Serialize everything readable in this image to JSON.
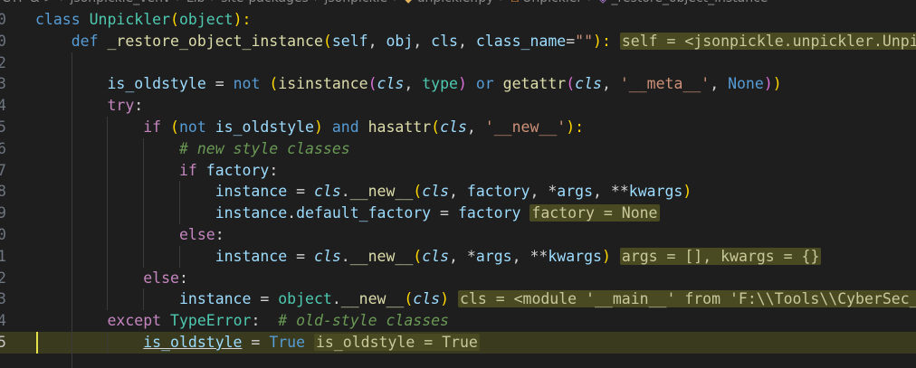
{
  "breadcrumb": {
    "items": [
      "CTF & >",
      "jsonpickle_venv",
      "Lib",
      "site-packages",
      "jsonpickle",
      "unpickler.py",
      "Unpickler",
      "_restore_object_instance"
    ]
  },
  "editor": {
    "lines": [
      {
        "number": "0",
        "tokens": [
          [
            "kw",
            "class "
          ],
          [
            "cls",
            "Unpickler"
          ],
          [
            "paren1",
            "("
          ],
          [
            "cls",
            "object"
          ],
          [
            "paren1",
            "):"
          ]
        ]
      },
      {
        "number": "0",
        "tokens": [
          [
            "pun",
            "    "
          ],
          [
            "kw",
            "def "
          ],
          [
            "fn",
            "_restore_object_instance"
          ],
          [
            "paren1",
            "("
          ],
          [
            "param",
            "self"
          ],
          [
            "pun",
            ", "
          ],
          [
            "param",
            "obj"
          ],
          [
            "pun",
            ", "
          ],
          [
            "param",
            "cls"
          ],
          [
            "pun",
            ", "
          ],
          [
            "param",
            "class_name"
          ],
          [
            "op",
            "="
          ],
          [
            "str",
            "\"\""
          ],
          [
            "paren1",
            "):"
          ],
          [
            "pun",
            " "
          ],
          [
            "inlay",
            "self = <jsonpickle.unpickler.Unpickl"
          ]
        ]
      },
      {
        "number": "2",
        "tokens": []
      },
      {
        "number": "3",
        "tokens": [
          [
            "pun",
            "        "
          ],
          [
            "var",
            "is_oldstyle"
          ],
          [
            "op",
            " = "
          ],
          [
            "kw",
            "not "
          ],
          [
            "paren1",
            "("
          ],
          [
            "fn",
            "isinstance"
          ],
          [
            "paren2",
            "("
          ],
          [
            "cls-ital",
            "cls"
          ],
          [
            "pun",
            ", "
          ],
          [
            "cls",
            "type"
          ],
          [
            "paren2",
            ")"
          ],
          [
            "kw",
            " or "
          ],
          [
            "fn",
            "getattr"
          ],
          [
            "paren2",
            "("
          ],
          [
            "cls-ital",
            "cls"
          ],
          [
            "pun",
            ", "
          ],
          [
            "str",
            "'__meta__'"
          ],
          [
            "pun",
            ", "
          ],
          [
            "constb",
            "None"
          ],
          [
            "paren2",
            ")"
          ],
          [
            "paren1",
            ")"
          ]
        ]
      },
      {
        "number": "4",
        "tokens": [
          [
            "pun",
            "        "
          ],
          [
            "ctrl",
            "try"
          ],
          [
            "pun",
            ":"
          ]
        ]
      },
      {
        "number": "5",
        "tokens": [
          [
            "pun",
            "            "
          ],
          [
            "ctrl",
            "if "
          ],
          [
            "paren1",
            "("
          ],
          [
            "kw",
            "not "
          ],
          [
            "var",
            "is_oldstyle"
          ],
          [
            "paren1",
            ")"
          ],
          [
            "kw",
            " and "
          ],
          [
            "fn",
            "hasattr"
          ],
          [
            "paren1",
            "("
          ],
          [
            "cls-ital",
            "cls"
          ],
          [
            "pun",
            ", "
          ],
          [
            "str",
            "'__new__'"
          ],
          [
            "paren1",
            "):"
          ]
        ]
      },
      {
        "number": "6",
        "tokens": [
          [
            "pun",
            "                "
          ],
          [
            "cmt",
            "# new style classes"
          ]
        ]
      },
      {
        "number": "7",
        "tokens": [
          [
            "pun",
            "                "
          ],
          [
            "ctrl",
            "if "
          ],
          [
            "var",
            "factory"
          ],
          [
            "pun",
            ":"
          ]
        ]
      },
      {
        "number": "8",
        "tokens": [
          [
            "pun",
            "                    "
          ],
          [
            "var",
            "instance"
          ],
          [
            "op",
            " = "
          ],
          [
            "cls-ital",
            "cls"
          ],
          [
            "pun",
            "."
          ],
          [
            "fn",
            "__new__"
          ],
          [
            "paren1",
            "("
          ],
          [
            "cls-ital",
            "cls"
          ],
          [
            "pun",
            ", "
          ],
          [
            "var",
            "factory"
          ],
          [
            "pun",
            ", "
          ],
          [
            "op",
            "*"
          ],
          [
            "var",
            "args"
          ],
          [
            "pun",
            ", "
          ],
          [
            "op",
            "**"
          ],
          [
            "var",
            "kwargs"
          ],
          [
            "paren1",
            ")"
          ]
        ]
      },
      {
        "number": "9",
        "tokens": [
          [
            "pun",
            "                    "
          ],
          [
            "var",
            "instance"
          ],
          [
            "pun",
            "."
          ],
          [
            "var",
            "default_factory"
          ],
          [
            "op",
            " = "
          ],
          [
            "var",
            "factory"
          ],
          [
            "pun",
            " "
          ],
          [
            "inlay",
            "factory = None"
          ]
        ]
      },
      {
        "number": "0",
        "tokens": [
          [
            "pun",
            "                "
          ],
          [
            "ctrl",
            "else"
          ],
          [
            "pun",
            ":"
          ]
        ]
      },
      {
        "number": "1",
        "tokens": [
          [
            "pun",
            "                    "
          ],
          [
            "var",
            "instance"
          ],
          [
            "op",
            " = "
          ],
          [
            "cls-ital",
            "cls"
          ],
          [
            "pun",
            "."
          ],
          [
            "fn",
            "__new__"
          ],
          [
            "paren1",
            "("
          ],
          [
            "cls-ital",
            "cls"
          ],
          [
            "pun",
            ", "
          ],
          [
            "op",
            "*"
          ],
          [
            "var",
            "args"
          ],
          [
            "pun",
            ", "
          ],
          [
            "op",
            "**"
          ],
          [
            "var",
            "kwargs"
          ],
          [
            "paren1",
            ")"
          ],
          [
            "pun",
            " "
          ],
          [
            "inlay",
            "args = [], kwargs = {}"
          ]
        ]
      },
      {
        "number": "2",
        "tokens": [
          [
            "pun",
            "            "
          ],
          [
            "ctrl",
            "else"
          ],
          [
            "pun",
            ":"
          ]
        ]
      },
      {
        "number": "3",
        "tokens": [
          [
            "pun",
            "                "
          ],
          [
            "var",
            "instance"
          ],
          [
            "op",
            " = "
          ],
          [
            "cls",
            "object"
          ],
          [
            "pun",
            "."
          ],
          [
            "fn",
            "__new__"
          ],
          [
            "paren1",
            "("
          ],
          [
            "cls-ital",
            "cls"
          ],
          [
            "paren1",
            ")"
          ],
          [
            "pun",
            " "
          ],
          [
            "inlay",
            "cls = <module '__main__' from 'F:\\\\Tools\\\\CyberSec_Too"
          ]
        ]
      },
      {
        "number": "4",
        "tokens": [
          [
            "pun",
            "        "
          ],
          [
            "ctrl",
            "except "
          ],
          [
            "cls",
            "TypeError"
          ],
          [
            "pun",
            ":  "
          ],
          [
            "cmt",
            "# old-style classes"
          ]
        ]
      },
      {
        "number": "5",
        "current": true,
        "tokens": [
          [
            "pun",
            "            "
          ],
          [
            "var-u",
            "is_oldstyle"
          ],
          [
            "op",
            " = "
          ],
          [
            "constb",
            "True"
          ],
          [
            "pun",
            " "
          ],
          [
            "inlay",
            "is_oldstyle = True"
          ]
        ]
      },
      {
        "number": "",
        "tokens": []
      }
    ]
  },
  "colors": {
    "background": "#1e1e1e",
    "current_line": "#3a3a1f",
    "inlay_bg": "#4a4a22"
  }
}
